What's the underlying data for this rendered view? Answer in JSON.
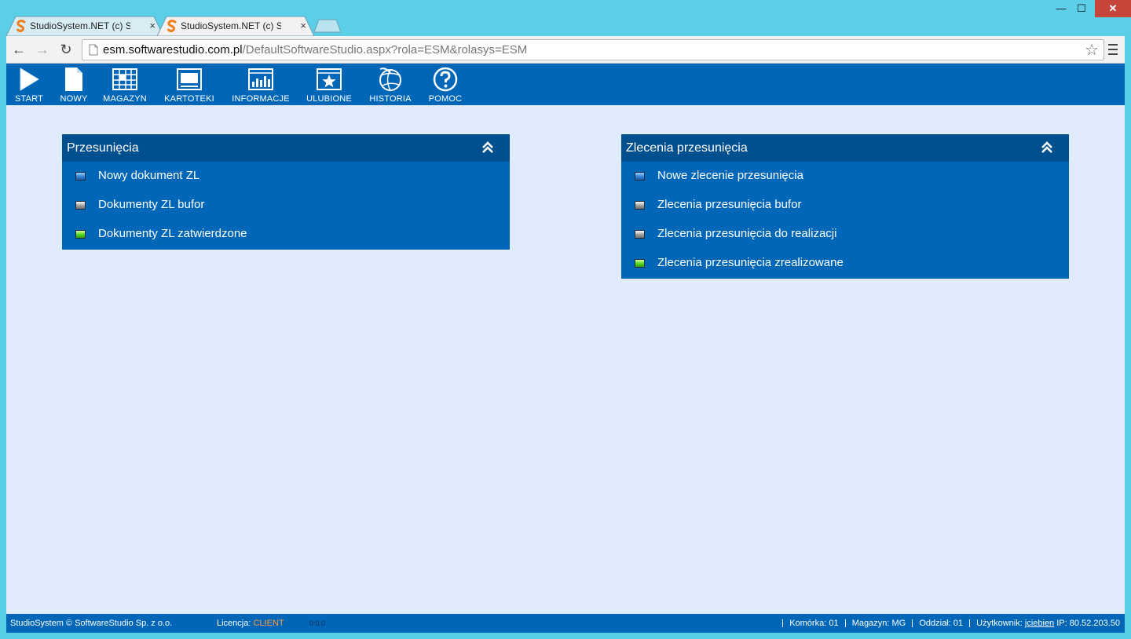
{
  "browser": {
    "tabs": [
      {
        "title": "StudioSystem.NET (c) Soft",
        "active": false
      },
      {
        "title": "StudioSystem.NET (c) Soft",
        "active": true
      }
    ],
    "tab_close_glyph": "×",
    "window_controls": {
      "minimize": "—",
      "maximize": "☐",
      "close": "✕"
    },
    "url_host": "esm.softwarestudio.com.pl",
    "url_path": "/DefaultSoftwareStudio.aspx?rola=ESM&rolasys=ESM"
  },
  "appbar": {
    "items": [
      {
        "label": "START",
        "icon": "play-icon"
      },
      {
        "label": "NOWY",
        "icon": "new-document-icon"
      },
      {
        "label": "MAGAZYN",
        "icon": "warehouse-grid-icon"
      },
      {
        "label": "KARTOTEKI",
        "icon": "records-window-icon"
      },
      {
        "label": "INFORMACJE",
        "icon": "chart-window-icon"
      },
      {
        "label": "ULUBIONE",
        "icon": "star-icon"
      },
      {
        "label": "HISTORIA",
        "icon": "history-globe-icon"
      },
      {
        "label": "POMOC",
        "icon": "help-icon"
      }
    ]
  },
  "panels": [
    {
      "title": "Przesunięcia",
      "items": [
        {
          "label": "Nowy dokument ZL",
          "bullet": "blue"
        },
        {
          "label": "Dokumenty ZL bufor",
          "bullet": "grey"
        },
        {
          "label": "Dokumenty ZL zatwierdzone",
          "bullet": "green"
        }
      ]
    },
    {
      "title": "Zlecenia przesunięcia",
      "items": [
        {
          "label": "Nowe zlecenie przesunięcia",
          "bullet": "blue"
        },
        {
          "label": "Zlecenia przesunięcia bufor",
          "bullet": "grey"
        },
        {
          "label": "Zlecenia przesunięcia do realizacji",
          "bullet": "grey"
        },
        {
          "label": "Zlecenia przesunięcia zrealizowane",
          "bullet": "green"
        }
      ]
    }
  ],
  "footer": {
    "copyright": "StudioSystem © SoftwareStudio Sp. z o.o.",
    "license_label": "Licencja:",
    "license_value": "CLIENT",
    "version": "0:0.0",
    "komorka_label": "Komórka:",
    "komorka_value": "01",
    "magazyn_label": "Magazyn:",
    "magazyn_value": "MG",
    "oddzial_label": "Oddział:",
    "oddzial_value": "01",
    "user_label": "Użytkownik:",
    "user_value": "jciebien",
    "ip_label": "IP:",
    "ip_value": "80.52.203.50"
  },
  "colors": {
    "appbar": "#0067b8",
    "panel_header": "#004f8e",
    "content_bg": "#e0ecfc",
    "license_accent": "#ff9a3c",
    "titlebar": "#5ccfe8"
  }
}
